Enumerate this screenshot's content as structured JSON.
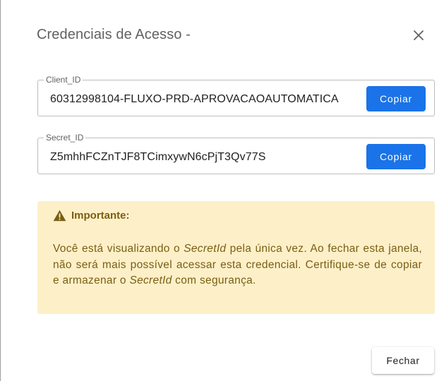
{
  "dialog": {
    "title": "Credenciais de Acesso -",
    "close_icon": "close-icon"
  },
  "client": {
    "label": "Client_ID",
    "value": "60312998104-FLUXO-PRD-APROVACAOAUTOMATICA",
    "copy_label": "Copiar"
  },
  "secret": {
    "label": "Secret_ID",
    "value": "Z5mhhFCZnTJF8TCimxywN6cPjT3Qv77S",
    "copy_label": "Copiar"
  },
  "alert": {
    "icon": "warning-icon",
    "title": "Importante:",
    "body_part1": "Você está visualizando o ",
    "body_em1": "SecretId",
    "body_part2": " pela única vez. Ao fechar esta janela, não será mais possível acessar esta credencial. Certifique-se de copiar e armazenar o ",
    "body_em2": "SecretId",
    "body_part3": " com segurança.",
    "background_color": "#fdf0c9",
    "text_color": "#7a5e12"
  },
  "footer": {
    "close_label": "Fechar"
  },
  "colors": {
    "primary": "#1a73e8"
  }
}
